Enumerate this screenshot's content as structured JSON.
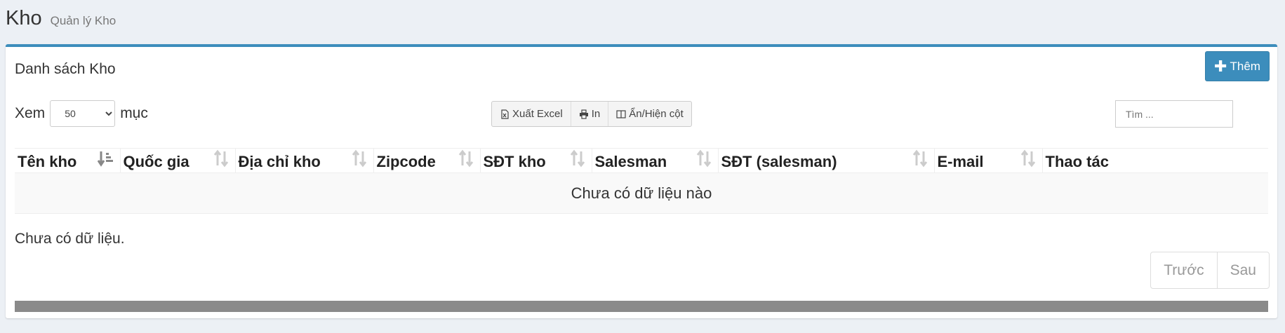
{
  "header": {
    "title": "Kho",
    "subtitle": "Quản lý Kho"
  },
  "box": {
    "title": "Danh sách Kho",
    "add_label": "Thêm"
  },
  "length": {
    "prefix": "Xem",
    "value": "50",
    "suffix": "mục"
  },
  "toolbar": {
    "excel": "Xuất Excel",
    "print": "In",
    "columns": "Ẩn/Hiện cột"
  },
  "search": {
    "placeholder": "Tìm ..."
  },
  "table": {
    "columns": [
      "Tên kho",
      "Quốc gia",
      "Địa chỉ kho",
      "Zipcode",
      "SĐT kho",
      "Salesman",
      "SĐT (salesman)",
      "E-mail",
      "Thao tác"
    ],
    "empty": "Chưa có dữ liệu nào"
  },
  "info": "Chưa có dữ liệu.",
  "pager": {
    "prev": "Trước",
    "next": "Sau"
  },
  "colors": {
    "accent": "#3c8dbc",
    "background": "#ecf0f5"
  }
}
